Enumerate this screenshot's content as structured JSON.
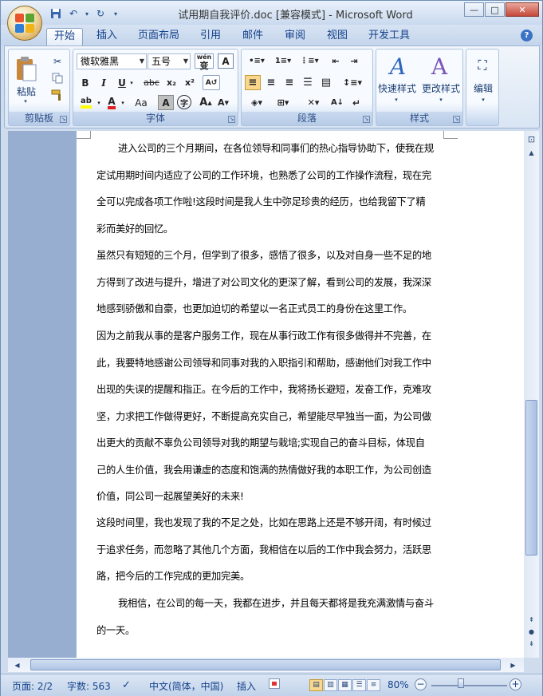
{
  "window": {
    "title": "试用期自我评价.doc [兼容模式] - Microsoft Word",
    "minimize": "—",
    "maximize": "□",
    "close": "✕"
  },
  "qat": {
    "save_icon": "floppy-icon",
    "undo": "↶",
    "redo": "↻",
    "more": "▾"
  },
  "tabs": [
    "开始",
    "插入",
    "页面布局",
    "引用",
    "邮件",
    "审阅",
    "视图",
    "开发工具"
  ],
  "ribbon": {
    "clipboard": {
      "label": "剪贴板",
      "paste": "粘贴"
    },
    "font": {
      "label": "字体",
      "font_name": "微软雅黑",
      "font_size": "五号",
      "wen": "wén",
      "bold": "B",
      "italic": "I",
      "underline": "U",
      "strike": "abc",
      "sub": "x₂",
      "sup": "x²",
      "aa": "Aa"
    },
    "paragraph": {
      "label": "段落"
    },
    "styles": {
      "label": "样式",
      "quick_styles": "快速样式",
      "change_styles": "更改样式"
    },
    "edit": {
      "label": "编辑"
    }
  },
  "document": {
    "paragraphs": [
      {
        "lines": [
          "进入公司的三个月期间，在各位领导和同事们的热心指导协助下，使我在规",
          "定试用期时间内适应了公司的工作环境，也熟悉了公司的工作操作流程，现在完",
          "全可以完成各项工作啦!这段时间是我人生中弥足珍贵的经历，也给我留下了精",
          "彩而美好的回忆。"
        ]
      },
      {
        "lines": [
          "虽然只有短短的三个月，但学到了很多，感悟了很多，以及对自身一些不足的地",
          "方得到了改进与提升，增进了对公司文化的更深了解，看到公司的发展，我深深",
          "地感到骄傲和自豪，也更加迫切的希望以一名正式员工的身份在这里工作。"
        ]
      },
      {
        "lines": [
          "因为之前我从事的是客户服务工作，现在从事行政工作有很多做得并不完善，在",
          "此，我要特地感谢公司领导和同事对我的入职指引和帮助，感谢他们对我工作中",
          "出现的失误的提醒和指正。在今后的工作中，我将扬长避短，发奋工作，克难攻",
          "坚，力求把工作做得更好，不断提高充实自己，希望能尽早独当一面，为公司做",
          "出更大的贡献不辜负公司领导对我的期望与栽培;实现自己的奋斗目标，体现自",
          "己的人生价值，我会用谦虚的态度和饱满的热情做好我的本职工作，为公司创造",
          "价值，同公司一起展望美好的未来!"
        ]
      },
      {
        "lines": [
          "这段时间里，我也发现了我的不足之处，比如在思路上还是不够开阔，有时候过",
          "于追求任务，而忽略了其他几个方面，我相信在以后的工作中我会努力，活跃思",
          "路，把今后的工作完成的更加完美。"
        ]
      },
      {
        "lines": [
          "我相信，在公司的每一天，我都在进步，并且每天都将是我充满激情与奋斗",
          "的一天。"
        ]
      }
    ]
  },
  "status": {
    "page": "页面: 2/2",
    "words": "字数: 563",
    "language": "中文(简体，中国)",
    "insert": "插入",
    "zoom": "80%",
    "zoom_level_percent": 80
  }
}
